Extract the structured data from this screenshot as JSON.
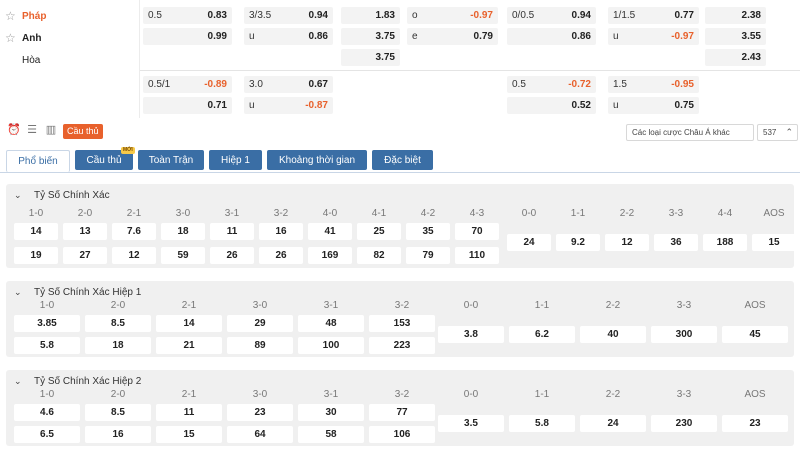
{
  "teams": {
    "home": {
      "name": "Pháp"
    },
    "away": {
      "name": "Anh"
    },
    "draw": {
      "name": "Hòa"
    }
  },
  "odds_rows": [
    {
      "cells": [
        {
          "label": "0.5",
          "value": "0.83"
        },
        {
          "label": "3/3.5",
          "value": "0.94"
        },
        {
          "value": "1.83"
        },
        {
          "label": "o",
          "value": "-0.97"
        },
        {
          "label": "0/0.5",
          "value": "0.94"
        },
        {
          "label": "1/1.5",
          "value": "0.77"
        },
        {
          "value": "2.38"
        }
      ]
    },
    {
      "cells": [
        {
          "value": "0.99"
        },
        {
          "label": "u",
          "value": "0.86"
        },
        {
          "value": "3.75"
        },
        {
          "label": "e",
          "value": "0.79"
        },
        {
          "value": "0.86"
        },
        {
          "label": "u",
          "value": "-0.97"
        },
        {
          "value": "3.55"
        }
      ]
    },
    {
      "cells": [
        {
          "value": "3.75"
        },
        {
          "value": "2.43"
        }
      ]
    },
    {
      "cells": [
        {
          "label": "0.5/1",
          "value": "-0.89"
        },
        {
          "label": "3.0",
          "value": "0.67"
        },
        {
          "label": "0.5",
          "value": "-0.72"
        },
        {
          "label": "1.5",
          "value": "-0.95"
        }
      ]
    },
    {
      "cells": [
        {
          "value": "0.71"
        },
        {
          "label": "u",
          "value": "-0.87"
        },
        {
          "value": "0.52"
        },
        {
          "label": "u",
          "value": "0.75"
        }
      ]
    }
  ],
  "toolbar": {
    "player_chip": "Cầu thủ",
    "market_select": "Các loại cược Châu Á khác",
    "count_select": "537"
  },
  "tabs": [
    {
      "label": "Phổ biến"
    },
    {
      "label": "Cầu thủ",
      "badge": "MỚI"
    },
    {
      "label": "Toàn Trận"
    },
    {
      "label": "Hiệp 1"
    },
    {
      "label": "Khoảng thời gian"
    },
    {
      "label": "Đặc biệt"
    }
  ],
  "sections": [
    {
      "title": "Tỷ Số Chính Xác",
      "pair_labels": [
        "1-0",
        "2-0",
        "2-1",
        "3-0",
        "3-1",
        "3-2",
        "4-0",
        "4-1",
        "4-2",
        "4-3"
      ],
      "pair_top": [
        "14",
        "13",
        "7.6",
        "18",
        "11",
        "16",
        "41",
        "25",
        "35",
        "70"
      ],
      "pair_bottom": [
        "19",
        "27",
        "12",
        "59",
        "26",
        "26",
        "169",
        "82",
        "79",
        "110"
      ],
      "single_labels": [
        "0-0",
        "1-1",
        "2-2",
        "3-3",
        "4-4",
        "AOS"
      ],
      "single_values": [
        "24",
        "9.2",
        "12",
        "36",
        "188",
        "15"
      ]
    },
    {
      "title": "Tỷ Số Chính Xác Hiệp 1",
      "pair_labels": [
        "1-0",
        "2-0",
        "2-1",
        "3-0",
        "3-1",
        "3-2"
      ],
      "pair_top": [
        "3.85",
        "8.5",
        "14",
        "29",
        "48",
        "153"
      ],
      "pair_bottom": [
        "5.8",
        "18",
        "21",
        "89",
        "100",
        "223"
      ],
      "single_labels": [
        "0-0",
        "1-1",
        "2-2",
        "3-3",
        "AOS"
      ],
      "single_values": [
        "3.8",
        "6.2",
        "40",
        "300",
        "45"
      ]
    },
    {
      "title": "Tỷ Số Chính Xác Hiệp 2",
      "pair_labels": [
        "1-0",
        "2-0",
        "2-1",
        "3-0",
        "3-1",
        "3-2"
      ],
      "pair_top": [
        "4.6",
        "8.5",
        "11",
        "23",
        "30",
        "77"
      ],
      "pair_bottom": [
        "6.5",
        "16",
        "15",
        "64",
        "58",
        "106"
      ],
      "single_labels": [
        "0-0",
        "1-1",
        "2-2",
        "3-3",
        "AOS"
      ],
      "single_values": [
        "3.5",
        "5.8",
        "24",
        "230",
        "23"
      ]
    }
  ],
  "colors": {
    "accent": "#e8612c",
    "tab_blue": "#3a6ea5",
    "negative": "#e8612c"
  }
}
